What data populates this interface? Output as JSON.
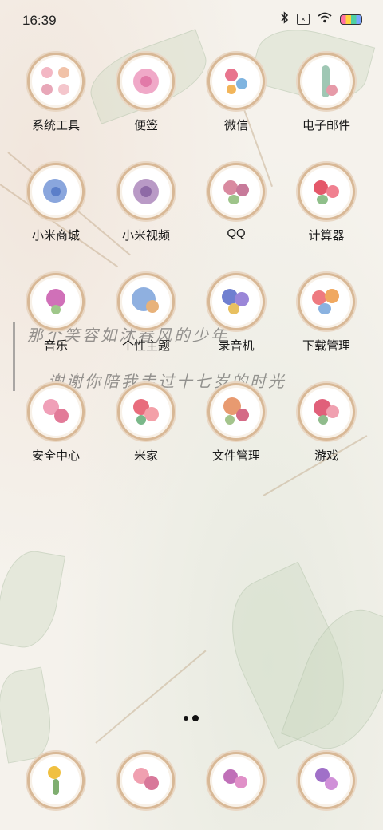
{
  "status_bar": {
    "time": "16:39",
    "icons": [
      "bluetooth-icon",
      "sim-icon",
      "wifi-icon",
      "battery-icon"
    ]
  },
  "apps": [
    {
      "label": "系统工具",
      "icon": "system-tools-icon"
    },
    {
      "label": "便签",
      "icon": "notes-icon"
    },
    {
      "label": "微信",
      "icon": "wechat-icon"
    },
    {
      "label": "电子邮件",
      "icon": "email-icon"
    },
    {
      "label": "小米商城",
      "icon": "mi-store-icon"
    },
    {
      "label": "小米视频",
      "icon": "mi-video-icon"
    },
    {
      "label": "QQ",
      "icon": "qq-icon"
    },
    {
      "label": "计算器",
      "icon": "calculator-icon"
    },
    {
      "label": "音乐",
      "icon": "music-icon"
    },
    {
      "label": "个性主题",
      "icon": "themes-icon"
    },
    {
      "label": "录音机",
      "icon": "recorder-icon"
    },
    {
      "label": "下载管理",
      "icon": "downloads-icon"
    },
    {
      "label": "安全中心",
      "icon": "security-icon"
    },
    {
      "label": "米家",
      "icon": "mijia-icon"
    },
    {
      "label": "文件管理",
      "icon": "file-manager-icon"
    },
    {
      "label": "游戏",
      "icon": "games-icon"
    }
  ],
  "poem": {
    "line1": "那个笑容如沐春风的少年",
    "line2": "谢谢你陪我走过十七岁的时光"
  },
  "dock": [
    {
      "icon": "phone-icon"
    },
    {
      "icon": "messages-icon"
    },
    {
      "icon": "browser-icon"
    },
    {
      "icon": "camera-icon"
    }
  ],
  "page_indicator": {
    "pages": 2,
    "current": 2
  },
  "colors": {
    "wreath": "#d8b896",
    "background": "#f5f2ec"
  }
}
